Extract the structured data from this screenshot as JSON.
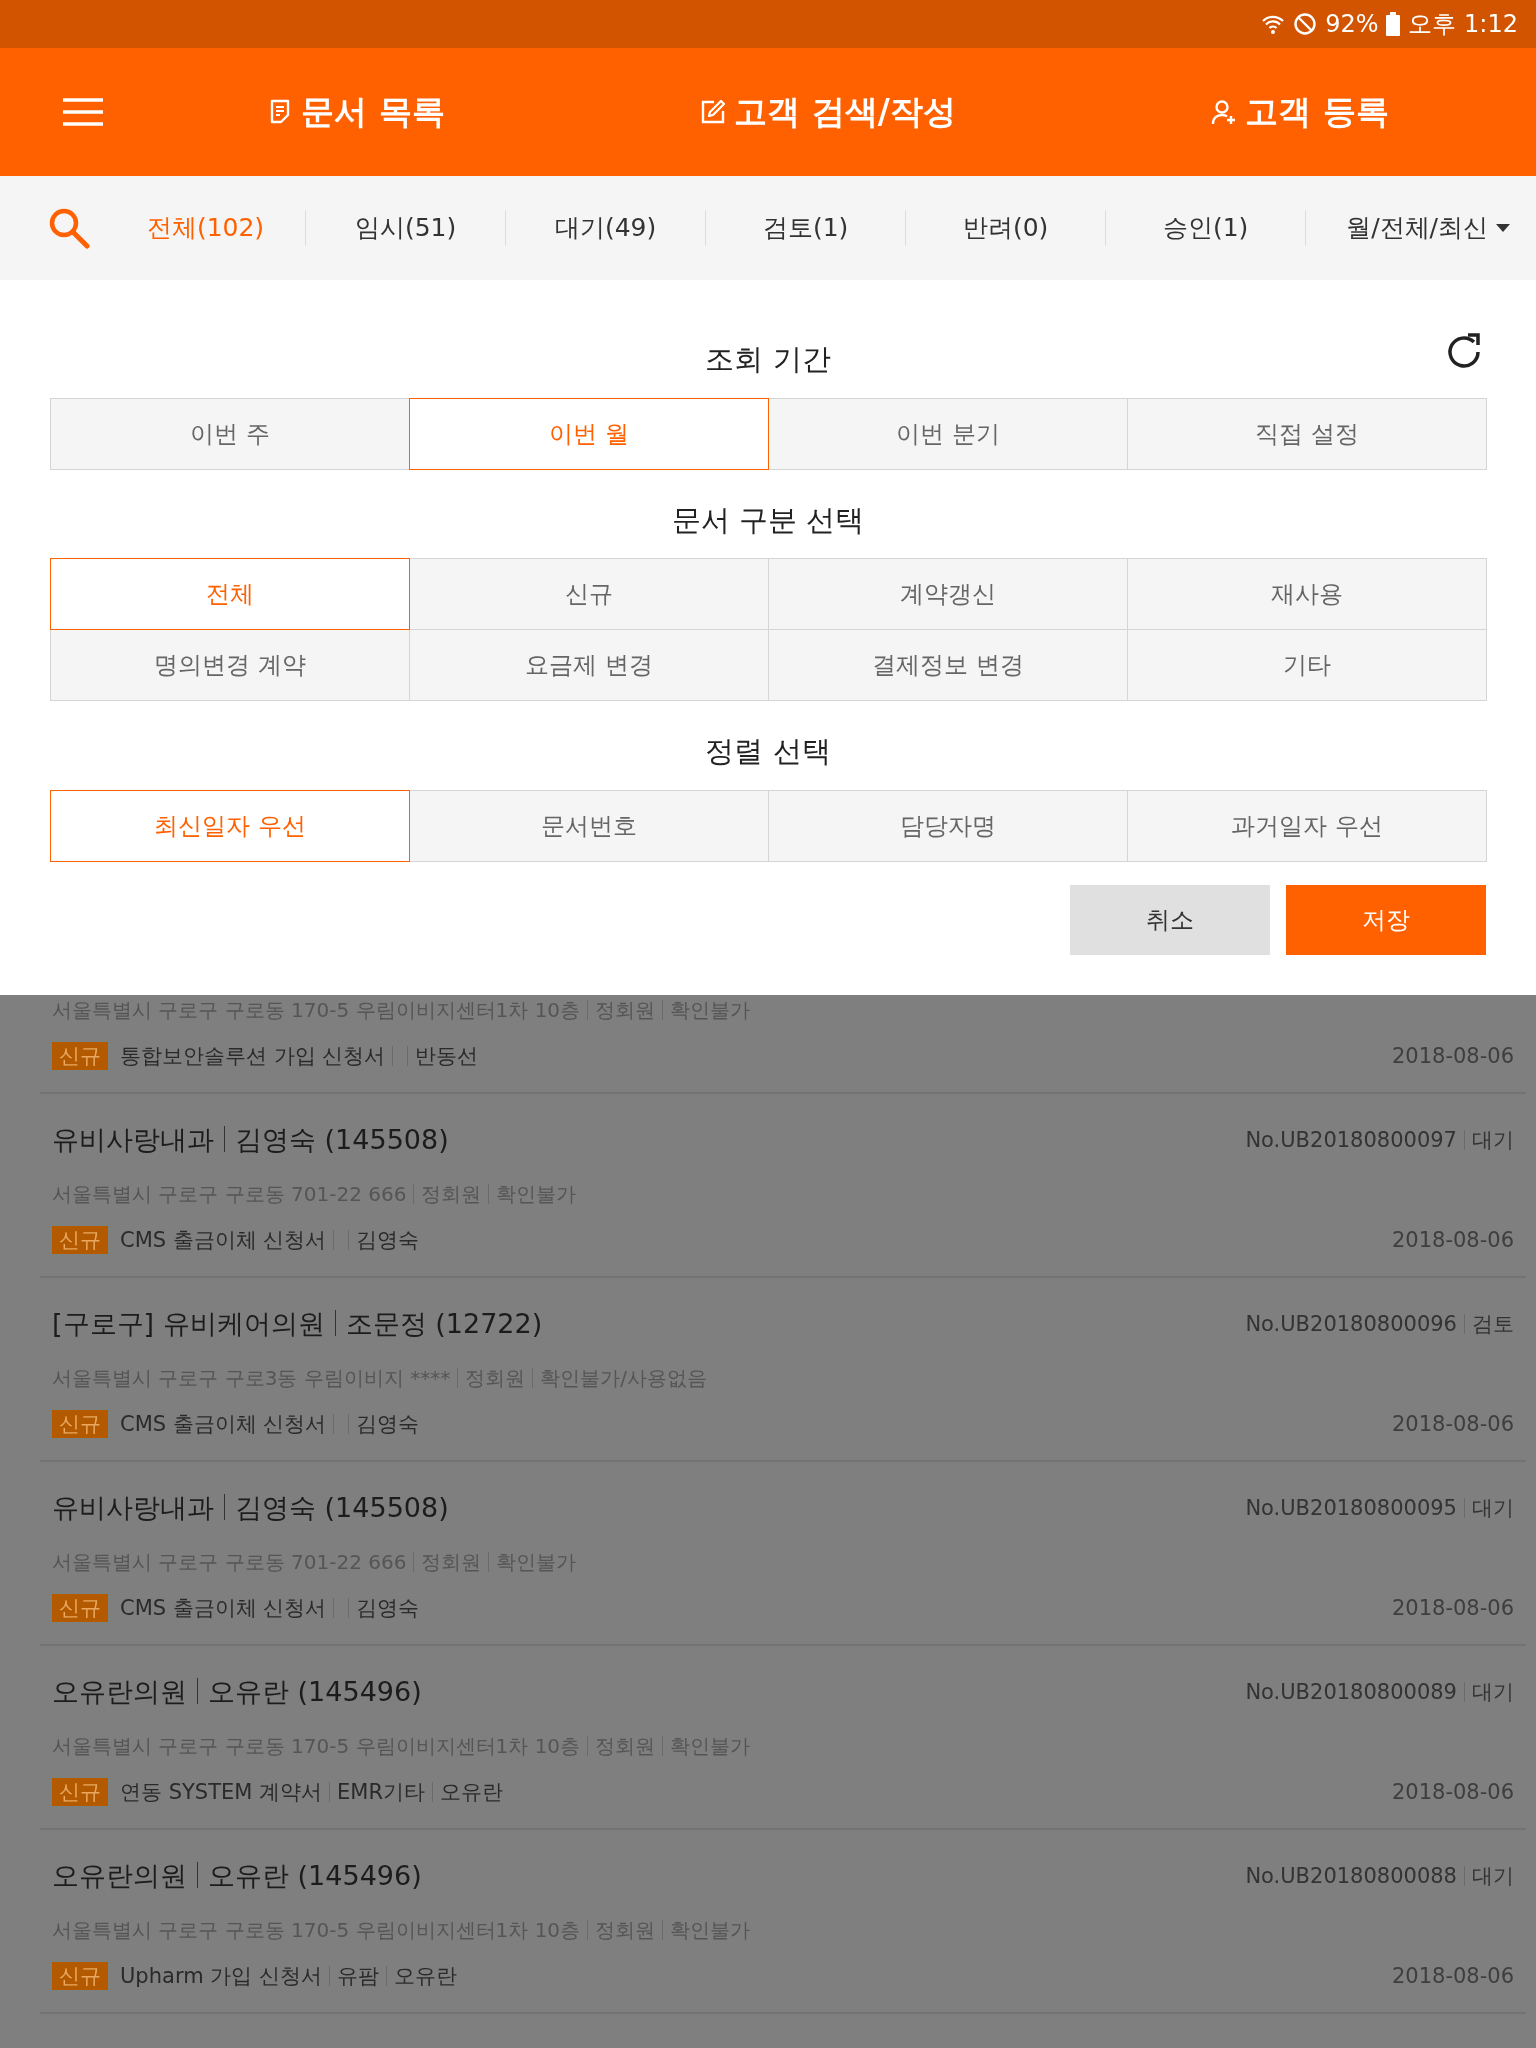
{
  "status_bar": {
    "battery": "92%",
    "time": "오후 1:12"
  },
  "header": {
    "nav": [
      {
        "label": "문서 목록",
        "kind": "document"
      },
      {
        "label": "고객 검색/작성",
        "kind": "edit"
      },
      {
        "label": "고객 등록",
        "kind": "person-add"
      }
    ]
  },
  "filter_bar": {
    "tabs": [
      {
        "label": "전체(102)",
        "selected": true
      },
      {
        "label": "임시(51)",
        "selected": false
      },
      {
        "label": "대기(49)",
        "selected": false
      },
      {
        "label": "검토(1)",
        "selected": false
      },
      {
        "label": "반려(0)",
        "selected": false
      },
      {
        "label": "승인(1)",
        "selected": false
      }
    ],
    "sort_dropdown": "월/전체/최신"
  },
  "filter_panel": {
    "sections": [
      {
        "title": "조회 기간",
        "options": [
          {
            "label": "이번 주",
            "selected": false
          },
          {
            "label": "이번 월",
            "selected": true
          },
          {
            "label": "이번 분기",
            "selected": false
          },
          {
            "label": "직접 설정",
            "selected": false
          }
        ]
      },
      {
        "title": "문서 구분 선택",
        "options": [
          {
            "label": "전체",
            "selected": true
          },
          {
            "label": "신규",
            "selected": false
          },
          {
            "label": "계약갱신",
            "selected": false
          },
          {
            "label": "재사용",
            "selected": false
          },
          {
            "label": "명의변경 계약",
            "selected": false
          },
          {
            "label": "요금제 변경",
            "selected": false
          },
          {
            "label": "결제정보 변경",
            "selected": false
          },
          {
            "label": "기타",
            "selected": false
          }
        ]
      },
      {
        "title": "정렬 선택",
        "options": [
          {
            "label": "최신일자 우선",
            "selected": true
          },
          {
            "label": "문서번호",
            "selected": false
          },
          {
            "label": "담당자명",
            "selected": false
          },
          {
            "label": "과거일자 우선",
            "selected": false
          }
        ]
      }
    ],
    "buttons": [
      {
        "label": "취소",
        "kind": "secondary"
      },
      {
        "label": "저장",
        "kind": "primary"
      }
    ]
  },
  "documents": [
    {
      "address": "서울특별시 구로구 구로동 170-5 우림이비지센터1차 10층",
      "membership": "정회원",
      "verification": "확인불가",
      "tag": "신규",
      "form": "통합보안솔루션 가입 신청서",
      "manager": "반동선",
      "date": "2018-08-06"
    },
    {
      "clinic": "유비사랑내과",
      "contact": "김영숙 (145508)",
      "doc_no": "No.UB20180800097",
      "status": "대기",
      "address": "서울특별시 구로구 구로동 701-22  666",
      "membership": "정회원",
      "verification": "확인불가",
      "tag": "신규",
      "form": "CMS 출금이체 신청서",
      "manager": "김영숙",
      "date": "2018-08-06"
    },
    {
      "clinic": "[구로구] 유비케어의원",
      "contact": "조문정 (12722)",
      "doc_no": "No.UB20180800096",
      "status": "검토",
      "address": "서울특별시 구로구 구로3동 우림이비지 ****",
      "membership": "정회원",
      "verification": "확인불가/사용없음",
      "tag": "신규",
      "form": "CMS 출금이체 신청서",
      "manager": "김영숙",
      "date": "2018-08-06"
    },
    {
      "clinic": "유비사랑내과",
      "contact": "김영숙 (145508)",
      "doc_no": "No.UB20180800095",
      "status": "대기",
      "address": "서울특별시 구로구 구로동 701-22  666",
      "membership": "정회원",
      "verification": "확인불가",
      "tag": "신규",
      "form": "CMS 출금이체 신청서",
      "manager": "김영숙",
      "date": "2018-08-06"
    },
    {
      "clinic": "오유란의원",
      "contact": "오유란 (145496)",
      "doc_no": "No.UB20180800089",
      "status": "대기",
      "address": "서울특별시 구로구 구로동 170-5 우림이비지센터1차 10층",
      "membership": "정회원",
      "verification": "확인불가",
      "tag": "신규",
      "form": "연동 SYSTEM 계약서",
      "category": "EMR기타",
      "manager": "오유란",
      "date": "2018-08-06"
    },
    {
      "clinic": "오유란의원",
      "contact": "오유란 (145496)",
      "doc_no": "No.UB20180800088",
      "status": "대기",
      "address": "서울특별시 구로구 구로동 170-5 우림이비지센터1차 10층",
      "membership": "정회원",
      "verification": "확인불가",
      "tag": "신규",
      "form": "Upharm 가입 신청서",
      "category": "유팜",
      "manager": "오유란",
      "date": "2018-08-06"
    }
  ]
}
